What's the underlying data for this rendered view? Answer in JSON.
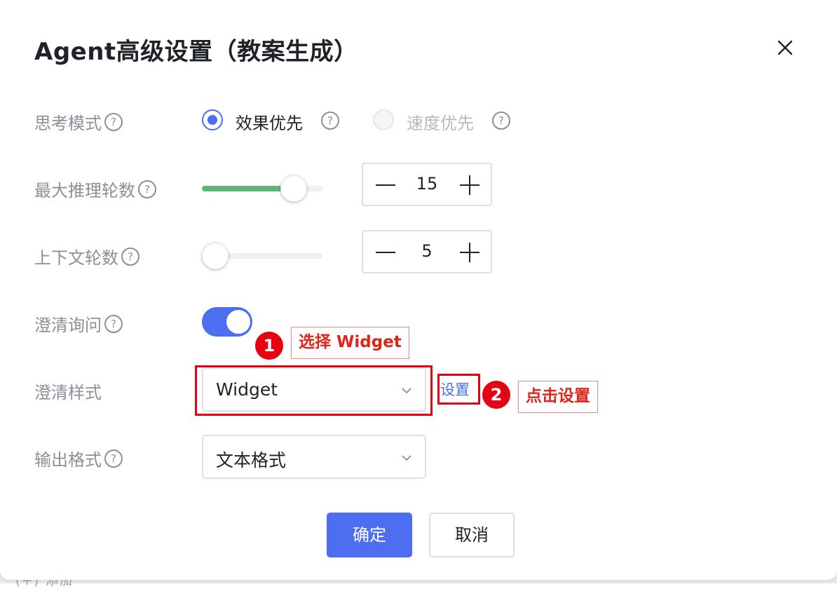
{
  "dialog": {
    "title": "Agent高级设置（教案生成）",
    "close_icon": "close-icon"
  },
  "thinking_mode": {
    "label": "思考模式",
    "options": [
      {
        "label": "效果优先",
        "selected": true,
        "disabled": false
      },
      {
        "label": "速度优先",
        "selected": false,
        "disabled": true
      }
    ]
  },
  "max_rounds": {
    "label": "最大推理轮数",
    "value": "15",
    "slider_fraction": 0.76
  },
  "context_rounds": {
    "label": "上下文轮数",
    "value": "5",
    "slider_fraction": 0.0
  },
  "clarify_query": {
    "label": "澄清询问",
    "enabled": true
  },
  "clarify_style": {
    "label": "澄清样式",
    "value": "Widget",
    "settings_link": "设置"
  },
  "output_format": {
    "label": "输出格式",
    "value": "文本格式"
  },
  "annotations": [
    {
      "number": "1",
      "text": "选择 Widget"
    },
    {
      "number": "2",
      "text": "点击设置"
    }
  ],
  "footer": {
    "confirm_label": "确定",
    "cancel_label": "取消"
  },
  "background_fragment": "(+) 添加 ^",
  "colors": {
    "accent": "#4e6ef2",
    "slider_fill": "#5cb57d",
    "annotation_red": "#e60012"
  }
}
